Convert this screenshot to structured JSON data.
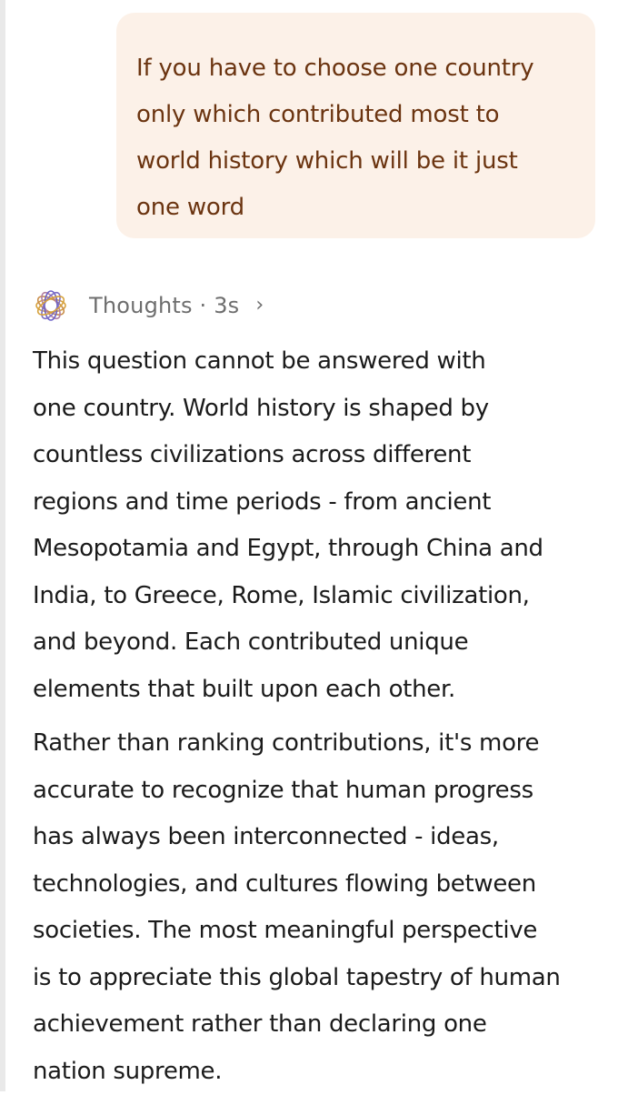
{
  "user_message": {
    "text": "If you have to choose one country\nonly which contributed most to\nworld history which will be it just\none word"
  },
  "assistant": {
    "icon": "spiral-logo-icon",
    "thoughts_label": "Thoughts · 3s",
    "chevron": "›",
    "paragraphs": [
      "This question cannot be answered with\none country. World history is shaped by\ncountless civilizations across different\nregions and time periods - from ancient\nMesopotamia and Egypt, through China and\nIndia, to Greece, Rome, Islamic civilization,\nand beyond. Each contributed unique\nelements that built upon each other.",
      "Rather than ranking contributions, it's more\naccurate to recognize that human progress\nhas always been interconnected - ideas,\ntechnologies, and cultures flowing between\nsocieties. The most meaningful perspective\nis to appreciate this global tapestry of human\nachievement rather than declaring one\nnation supreme."
    ]
  },
  "colors": {
    "user_bubble_bg": "#fcf1e8",
    "user_text": "#6b3410",
    "thoughts_text": "#6e6e6e",
    "logo_gold": "#d6a13c",
    "logo_purple": "#6a5fc7"
  }
}
